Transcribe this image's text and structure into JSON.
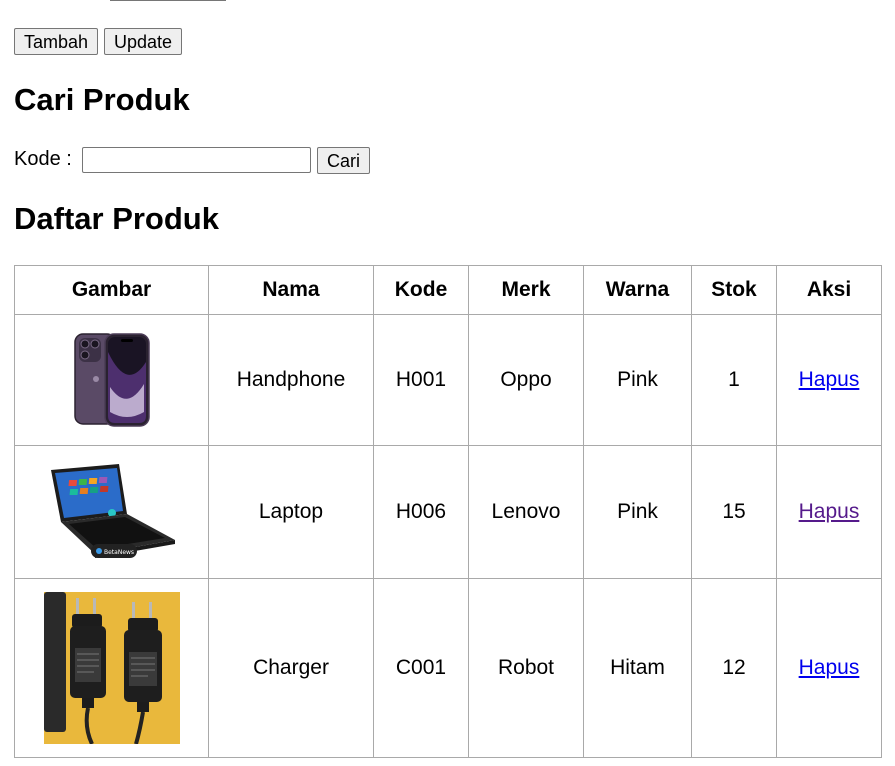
{
  "form": {
    "tambah_label": "Tambah",
    "update_label": "Update"
  },
  "search": {
    "heading": "Cari Produk",
    "label": "Kode :",
    "value": "",
    "button_label": "Cari"
  },
  "list": {
    "heading": "Daftar Produk",
    "columns": [
      "Gambar",
      "Nama",
      "Kode",
      "Merk",
      "Warna",
      "Stok",
      "Aksi"
    ],
    "rows": [
      {
        "image": "smartphone-photo",
        "nama": "Handphone",
        "kode": "H001",
        "merk": "Oppo",
        "warna": "Pink",
        "stok": "1",
        "aksi": "Hapus"
      },
      {
        "image": "laptop-photo",
        "nama": "Laptop",
        "kode": "H006",
        "merk": "Lenovo",
        "warna": "Pink",
        "stok": "15",
        "aksi": "Hapus"
      },
      {
        "image": "charger-photo",
        "nama": "Charger",
        "kode": "C001",
        "merk": "Robot",
        "warna": "Hitam",
        "stok": "12",
        "aksi": "Hapus"
      }
    ]
  },
  "colors": {
    "link": "#0000ee",
    "link_visited": "#551a8b",
    "table_border": "#a9a9a9",
    "button_bg": "#efefef"
  }
}
